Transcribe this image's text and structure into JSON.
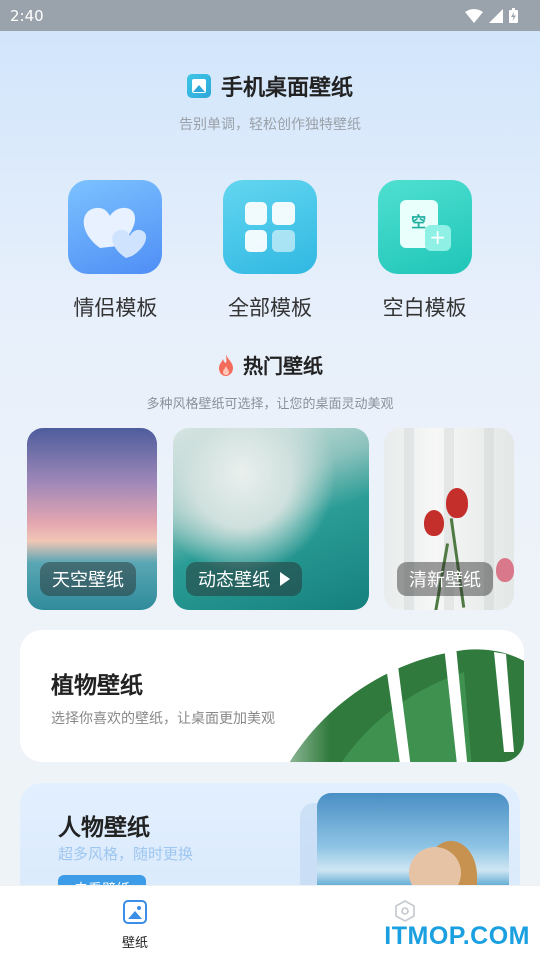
{
  "status_bar": {
    "time": "2:40"
  },
  "header": {
    "title": "手机桌面壁纸",
    "subtitle": "告别单调，轻松创作独特壁纸"
  },
  "templates": [
    {
      "label": "情侣模板",
      "icon": "hearts-icon"
    },
    {
      "label": "全部模板",
      "icon": "grid-icon"
    },
    {
      "label": "空白模板",
      "icon": "blank-doc-icon",
      "glyph": "空",
      "plus": "+"
    }
  ],
  "hot": {
    "title": "热门壁纸",
    "subtitle": "多种风格壁纸可选择，让您的桌面灵动美观"
  },
  "wallpaper_cards": [
    {
      "label": "天空壁纸"
    },
    {
      "label": "动态壁纸"
    },
    {
      "label": "清新壁纸"
    }
  ],
  "plant_card": {
    "title": "植物壁纸",
    "subtitle": "选择你喜欢的壁纸，让桌面更加美观"
  },
  "people_card": {
    "title": "人物壁纸",
    "subtitle": "超多风格，随时更换",
    "button": "去看壁纸"
  },
  "tabs": [
    {
      "label": "壁纸",
      "active": true
    },
    {
      "label": ""
    }
  ],
  "watermark": "ITMOP.COM",
  "colors": {
    "accent": "#3a8ee6",
    "watermark": "#1a9fe0"
  }
}
